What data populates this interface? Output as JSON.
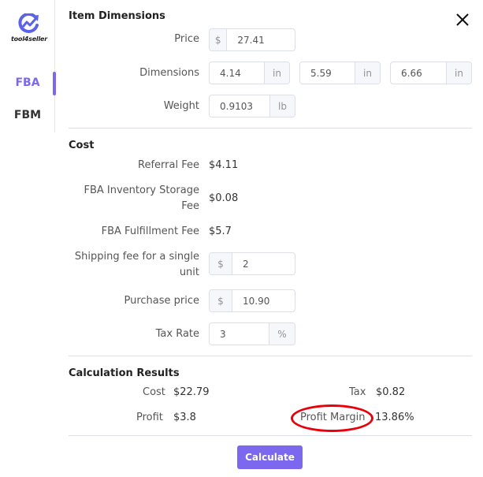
{
  "brand": {
    "name": "tool4seller",
    "logo_icon": "trend-up-icon"
  },
  "nav": {
    "items": [
      {
        "label": "FBA",
        "active": true
      },
      {
        "label": "FBM",
        "active": false
      }
    ]
  },
  "close_icon": "close-icon",
  "item_dimensions": {
    "title": "Item Dimensions",
    "price": {
      "label": "Price",
      "prefix": "$",
      "value": "27.41"
    },
    "dimensions": {
      "label": "Dimensions",
      "fields": [
        {
          "value": "4.14",
          "unit": "in"
        },
        {
          "value": "5.59",
          "unit": "in"
        },
        {
          "value": "6.66",
          "unit": "in"
        }
      ]
    },
    "weight": {
      "label": "Weight",
      "value": "0.9103",
      "unit": "lb"
    }
  },
  "cost": {
    "title": "Cost",
    "referral_fee": {
      "label": "Referral Fee",
      "value": "$4.11"
    },
    "storage_fee": {
      "label_line1": "FBA Inventory Storage",
      "label_line2": "Fee",
      "value": "$0.08"
    },
    "fulfillment_fee": {
      "label": "FBA Fulfillment Fee",
      "value": "$5.7"
    },
    "shipping_fee": {
      "label_line1": "Shipping fee for a single",
      "label_line2": "unit",
      "prefix": "$",
      "value": "2"
    },
    "purchase_price": {
      "label": "Purchase price",
      "prefix": "$",
      "value": "10.90"
    },
    "tax_rate": {
      "label": "Tax Rate",
      "value": "3",
      "unit": "%"
    }
  },
  "results": {
    "title": "Calculation Results",
    "cost": {
      "label": "Cost",
      "value": "$22.79"
    },
    "tax": {
      "label": "Tax",
      "value": "$0.82"
    },
    "profit": {
      "label": "Profit",
      "value": "$3.8"
    },
    "profit_margin": {
      "label": "Profit Margin",
      "value": "13.86%"
    }
  },
  "calculate_label": "Calculate",
  "colors": {
    "accent": "#7b68ee",
    "annotation": "#e8000b"
  }
}
